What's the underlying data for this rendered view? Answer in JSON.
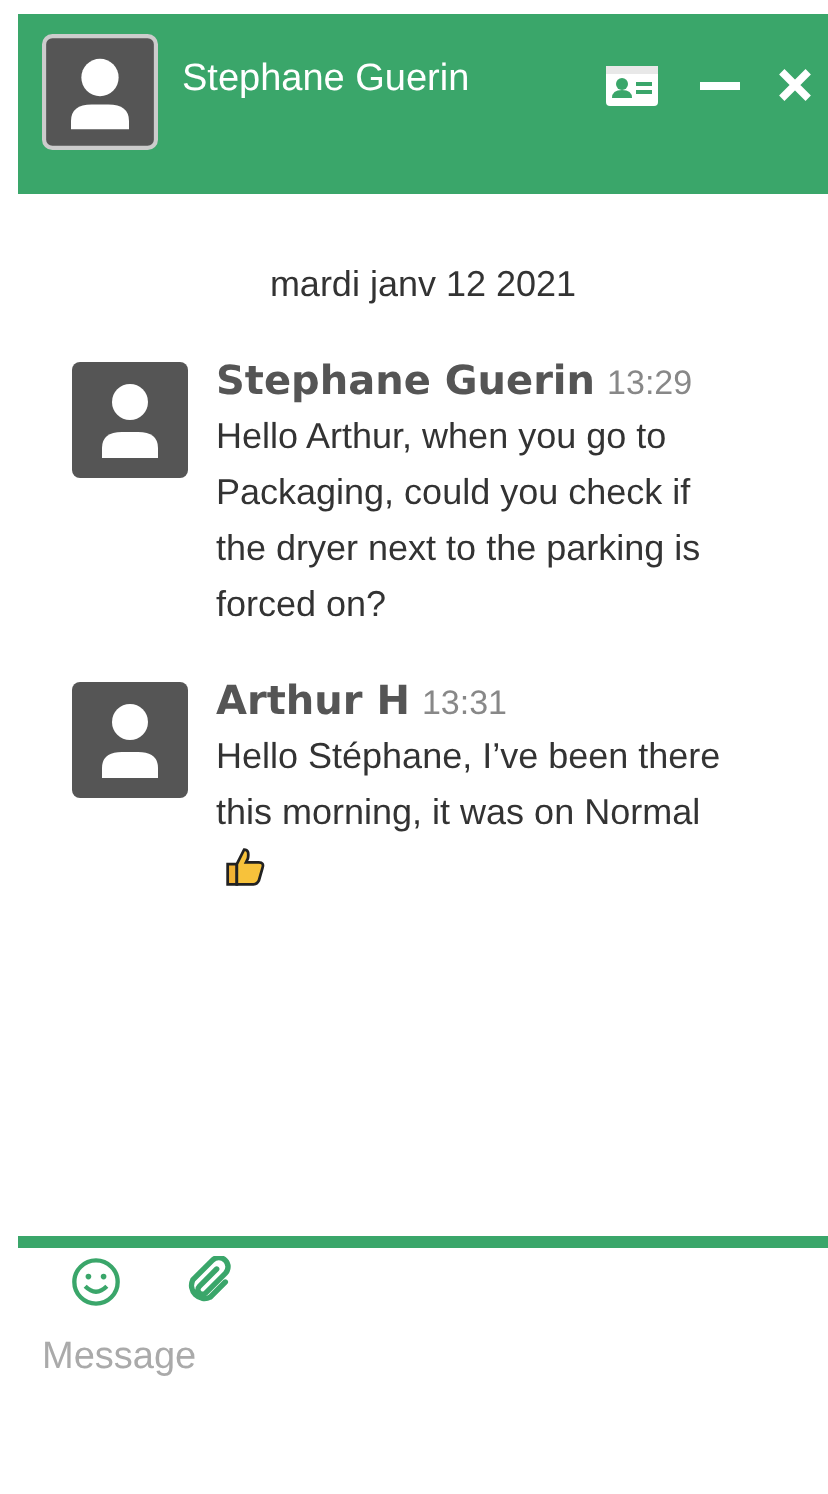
{
  "header": {
    "title": "Stephane Guerin"
  },
  "date": "mardi janv 12 2021",
  "messages": [
    {
      "author": "Stephane Guerin",
      "time": "13:29",
      "text": "Hello Arthur, when you go to Packaging, could you check if the dryer next to the parking is forced on?",
      "thumbs_up": false
    },
    {
      "author": "Arthur H",
      "time": "13:31",
      "text": "Hello Stéphane, I’ve been there this morning, it was on Normal",
      "thumbs_up": true
    }
  ],
  "composer": {
    "placeholder": "Message"
  }
}
